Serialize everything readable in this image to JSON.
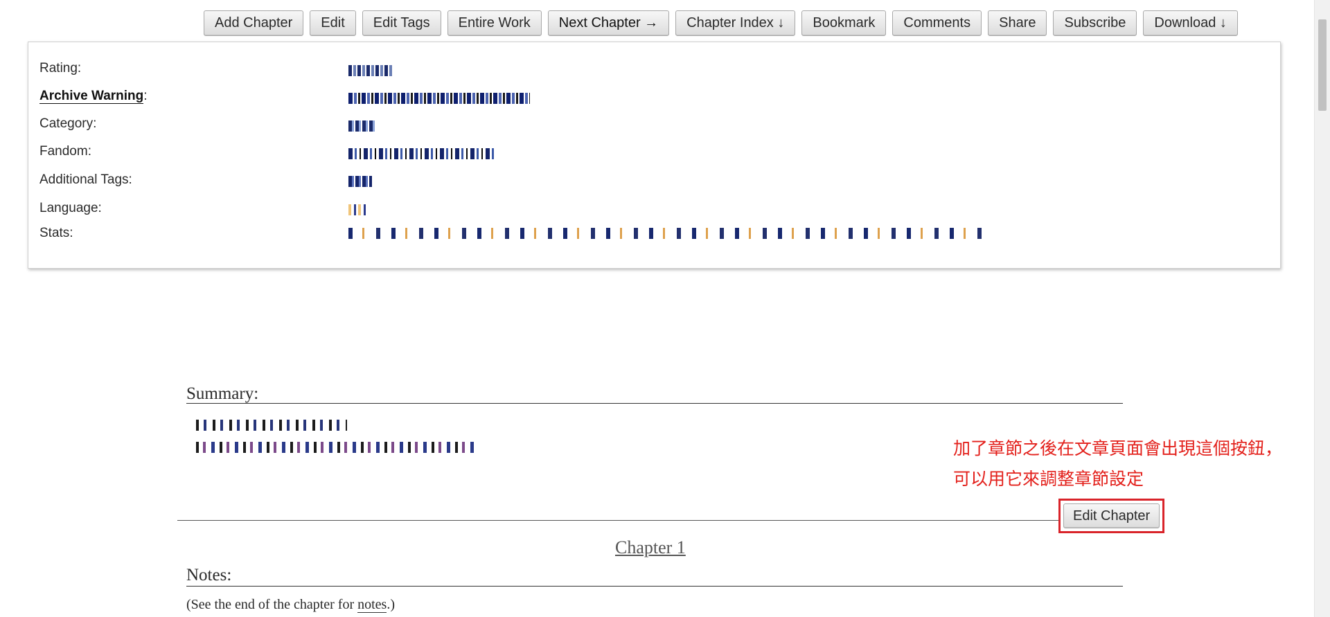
{
  "toolbar": {
    "buttons": [
      {
        "label": "Add Chapter"
      },
      {
        "label": "Edit"
      },
      {
        "label": "Edit Tags"
      },
      {
        "label": "Entire Work"
      },
      {
        "label": "Next Chapter →"
      },
      {
        "label": "Chapter Index ↓"
      },
      {
        "label": "Bookmark"
      },
      {
        "label": "Comments"
      },
      {
        "label": "Share"
      },
      {
        "label": "Subscribe"
      },
      {
        "label": "Download ↓"
      }
    ]
  },
  "meta": {
    "rating_label": "Rating:",
    "warning_label": "Archive Warning",
    "warning_colon": ":",
    "category_label": "Category:",
    "fandom_label": "Fandom:",
    "tags_label": "Additional Tags:",
    "language_label": "Language:",
    "stats_label": "Stats:"
  },
  "summary": {
    "heading": "Summary:"
  },
  "annotation": {
    "text": "加了章節之後在文章頁面會出現這個按鈕，可以用它來調整章節設定",
    "color": "#e3201b"
  },
  "chapter": {
    "edit_button": "Edit Chapter",
    "title": "Chapter 1",
    "notes_heading": "Notes:",
    "notes_prefix": "(See the end of the chapter for ",
    "notes_link": "notes",
    "notes_suffix": ".)"
  }
}
